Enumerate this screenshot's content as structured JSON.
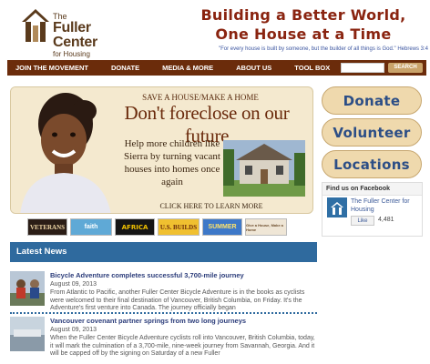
{
  "header": {
    "logo": {
      "the": "The",
      "name": "Fuller Center",
      "sub": "for Housing"
    },
    "tagline_line1": "Building a Better World,",
    "tagline_line2": "One House at a Time",
    "quote": "\"For every house is built by someone, but the builder of all things is God.\" Hebrews 3:4"
  },
  "nav": {
    "items": [
      "JOIN THE MOVEMENT",
      "DONATE",
      "MEDIA & MORE",
      "ABOUT US",
      "TOOL BOX"
    ],
    "search_placeholder": "",
    "search_button": "SEARCH"
  },
  "hero": {
    "kicker": "SAVE A HOUSE/MAKE A HOME",
    "title": "Don't foreclose on our future",
    "body": "Help more children like Sierra by turning vacant houses into homes once again",
    "cta": "CLICK HERE TO LEARN MORE"
  },
  "banners": [
    {
      "label": "VETERANS"
    },
    {
      "label": "faith"
    },
    {
      "label": "AFRICA"
    },
    {
      "label": "U.S. BUILDS"
    },
    {
      "label": "SUMMER"
    },
    {
      "label": "Give a House, Make a Home"
    }
  ],
  "sidebar": {
    "donate": "Donate",
    "volunteer": "Volunteer",
    "locations": "Locations"
  },
  "facebook": {
    "header": "Find us on Facebook",
    "page_name": "The Fuller Center for Housing",
    "like": "Like",
    "count": "4,481"
  },
  "news": {
    "header": "Latest News",
    "items": [
      {
        "title": "Bicycle Adventure completes successful 3,700-mile journey",
        "date": "August 09, 2013",
        "text": "From Atlantic to Pacific, another Fuller Center Bicycle Adventure is in the books as cyclists were welcomed to their final destination of Vancouver, British Columbia, on Friday. It's the Adventure's first venture into Canada. The journey officially began"
      },
      {
        "title": "Vancouver covenant partner springs from two long journeys",
        "date": "August 09, 2013",
        "text": "When the Fuller Center Bicycle Adventure cyclists roll into Vancouver, British Columbia, today, it will mark the culmination of a 3,700-mile, nine-week journey from Savannah, Georgia. And it will be capped off by the signing on Saturday of a new Fuller"
      }
    ]
  },
  "colors": {
    "nav_bg": "#6b2c0b",
    "tagline": "#8a2410",
    "accent_blue": "#2f6a9e",
    "button_bg": "#efd9ad",
    "button_text": "#2c4e86"
  }
}
